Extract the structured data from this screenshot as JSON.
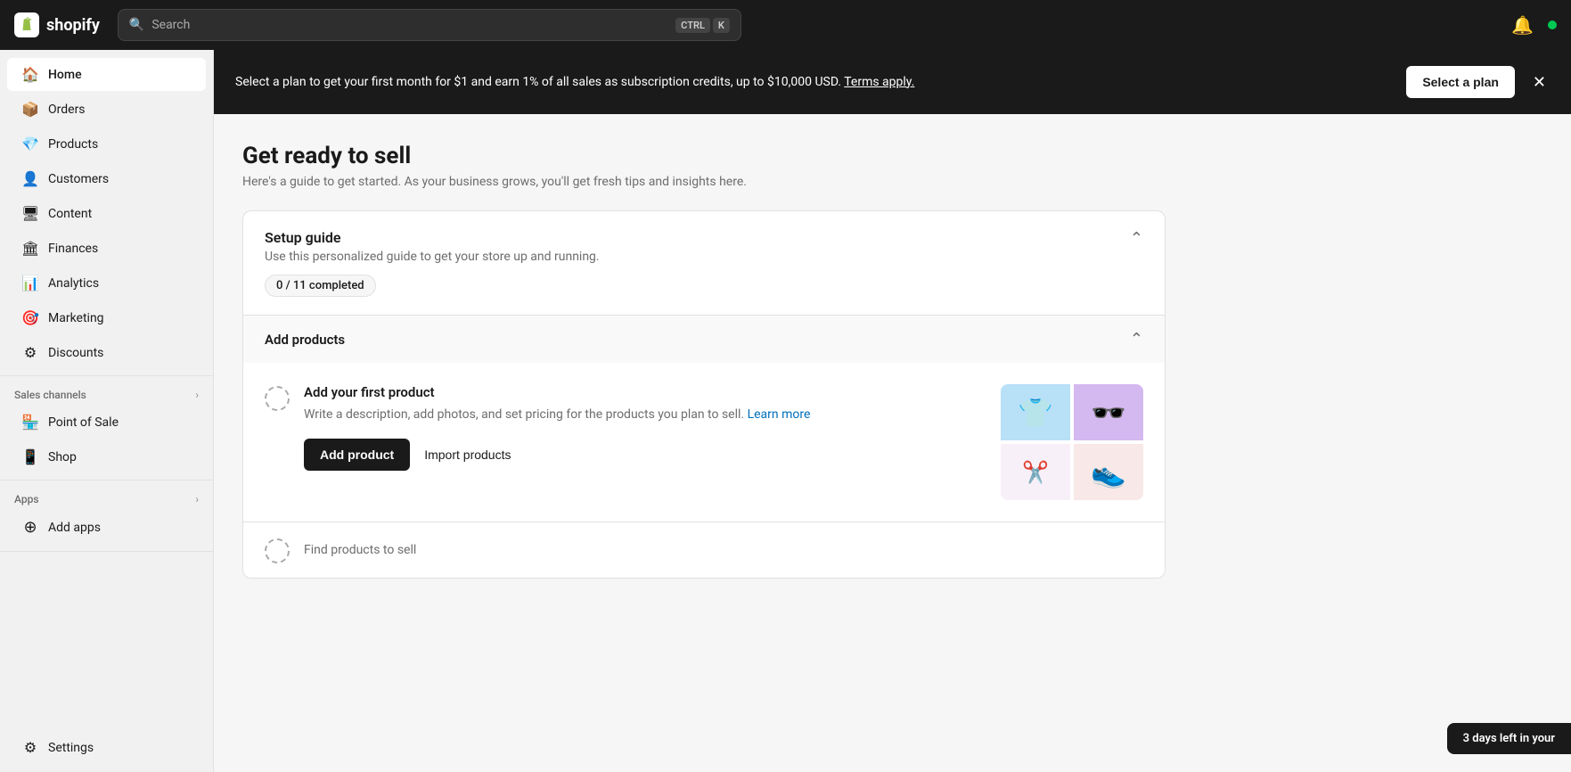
{
  "topnav": {
    "logo_text": "shopify",
    "search_placeholder": "Search",
    "shortcut_ctrl": "CTRL",
    "shortcut_k": "K"
  },
  "sidebar": {
    "items": [
      {
        "id": "home",
        "label": "Home",
        "icon": "🏠",
        "active": true
      },
      {
        "id": "orders",
        "label": "Orders",
        "icon": "📦",
        "active": false
      },
      {
        "id": "products",
        "label": "Products",
        "icon": "💎",
        "active": false
      },
      {
        "id": "customers",
        "label": "Customers",
        "icon": "👤",
        "active": false
      },
      {
        "id": "content",
        "label": "Content",
        "icon": "🖥",
        "active": false
      },
      {
        "id": "finances",
        "label": "Finances",
        "icon": "🏛",
        "active": false
      },
      {
        "id": "analytics",
        "label": "Analytics",
        "icon": "📊",
        "active": false
      },
      {
        "id": "marketing",
        "label": "Marketing",
        "icon": "🎯",
        "active": false
      },
      {
        "id": "discounts",
        "label": "Discounts",
        "icon": "⚙",
        "active": false
      }
    ],
    "sales_channels_label": "Sales channels",
    "sales_channel_items": [
      {
        "id": "point-of-sale",
        "label": "Point of Sale",
        "icon": "🏪"
      },
      {
        "id": "shop",
        "label": "Shop",
        "icon": "📱"
      }
    ],
    "apps_label": "Apps",
    "apps_items": [
      {
        "id": "add-apps",
        "label": "Add apps",
        "icon": "+"
      }
    ],
    "settings_label": "Settings",
    "settings_icon": "⚙"
  },
  "promo_banner": {
    "text": "Select a plan to get your first month for $1 and earn 1% of all sales as subscription credits, up to $10,000 USD.",
    "terms_link": "Terms apply.",
    "cta_label": "Select a plan"
  },
  "main": {
    "page_title": "Get ready to sell",
    "page_subtitle": "Here's a guide to get started. As your business grows, you'll get fresh tips and insights here.",
    "setup_guide": {
      "title": "Setup guide",
      "description": "Use this personalized guide to get your store up and running.",
      "progress_label": "0 / 11 completed"
    },
    "add_products_section": {
      "title": "Add products",
      "items": [
        {
          "title": "Add your first product",
          "description": "Write a description, add photos, and set pricing for the products you plan to sell.",
          "learn_more": "Learn more",
          "primary_btn": "Add product",
          "secondary_btn": "Import products",
          "illustrations": [
            "👕",
            "🕶️",
            "✂️",
            "👟"
          ]
        },
        {
          "title": "Find products to sell",
          "description": ""
        }
      ]
    }
  },
  "trial_badge": {
    "text": "3 days left in your"
  }
}
